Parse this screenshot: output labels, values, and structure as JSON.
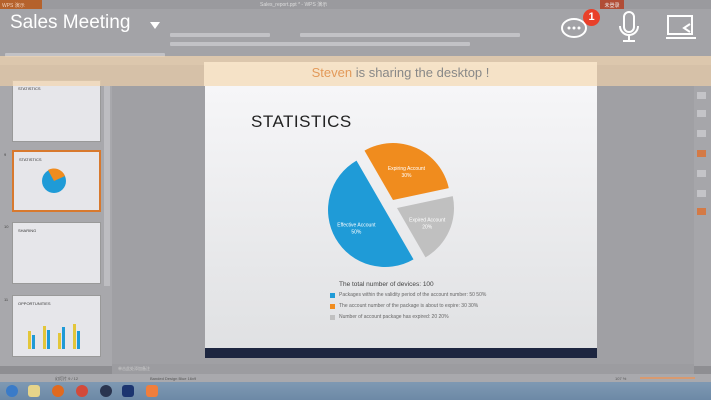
{
  "app": {
    "wps_label": "WPS 演示",
    "document_title": "Sales_report.ppt * - WPS 演示",
    "login_label": "未登录"
  },
  "meeting": {
    "title": "Sales Meeting",
    "chat_badge": "1",
    "sharer": "Steven",
    "sharing_text": " is sharing the desktop !"
  },
  "slide": {
    "title": "STATISTICS",
    "total": "The total number of devices: 100",
    "legend": [
      {
        "text": "Packages within the validity period of the account number: 50 50%",
        "color": "#1f9bd7"
      },
      {
        "text": "The account number of the package is about to expire: 30 30%",
        "color": "#f08c1e"
      },
      {
        "text": "Number of account package has expired: 20 20%",
        "color": "#c0c0c0"
      }
    ]
  },
  "chart_data": {
    "type": "pie",
    "slices": [
      {
        "label": "Effective Account",
        "value": 50,
        "display": "50%",
        "color": "#1f9bd7"
      },
      {
        "label": "Expiring Account",
        "value": 30,
        "display": "30%",
        "color": "#f08c1e"
      },
      {
        "label": "Expired Account",
        "value": 20,
        "display": "20%",
        "color": "#c0c0c0"
      }
    ]
  },
  "thumbnails": [
    {
      "num": "",
      "title": "STATISTICS"
    },
    {
      "num": "9",
      "title": "STATISTICS"
    },
    {
      "num": "10",
      "title": "SHARING"
    },
    {
      "num": "11",
      "title": "OPPORTUNITIES"
    }
  ],
  "notes_placeholder": "单击此处添加备注",
  "status": {
    "slide": "幻灯片 9 / 12",
    "theme": "Banded Design Blue 16x9",
    "zoom": "107 %"
  }
}
